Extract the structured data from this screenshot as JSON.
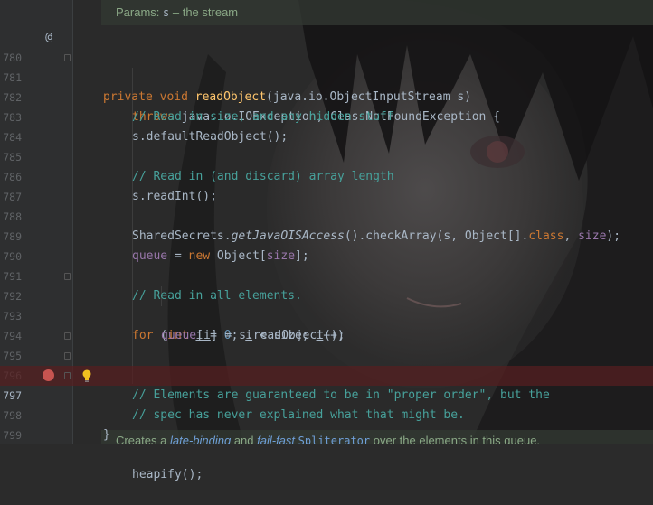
{
  "doc_top": {
    "label": "Params:",
    "param": "s",
    "desc": " – the stream"
  },
  "doc_bottom": {
    "text1": "Creates a ",
    "em1": "late-binding",
    "text2": " and ",
    "em2": "fail-fast",
    "text3": " ",
    "code": "Spliterator",
    "text4": " over the elements in this queue."
  },
  "lines": [
    {
      "num": "780"
    },
    {
      "num": "781"
    },
    {
      "num": "782"
    },
    {
      "num": "783"
    },
    {
      "num": "784"
    },
    {
      "num": "785"
    },
    {
      "num": "786"
    },
    {
      "num": "787"
    },
    {
      "num": "788"
    },
    {
      "num": "789"
    },
    {
      "num": "790"
    },
    {
      "num": "791"
    },
    {
      "num": "792"
    },
    {
      "num": "793"
    },
    {
      "num": "794"
    },
    {
      "num": "795"
    },
    {
      "num": "796"
    },
    {
      "num": "797"
    },
    {
      "num": "798"
    },
    {
      "num": "799"
    }
  ],
  "code": {
    "l780": {
      "kw1": "private",
      "kw2": "void",
      "fn": "readObject",
      "rest": "(java.io.ObjectInputStream s)"
    },
    "l781": {
      "kw": "throws",
      "rest": " java.io.IOException, ClassNotFoundException {"
    },
    "l782": {
      "cm": "// Read in size, and any hidden stuff"
    },
    "l783": {
      "text": "s.defaultReadObject();"
    },
    "l785": {
      "cm": "// Read in (and discard) array length"
    },
    "l786": {
      "text": "s.readInt();"
    },
    "l788": {
      "a": "SharedSecrets.",
      "it": "getJavaOISAccess",
      "b": "().checkArray(s, Object[].",
      "kw": "class",
      "c": ", ",
      "fld": "size",
      "d": ");"
    },
    "l789": {
      "fld": "queue",
      "a": " = ",
      "kw": "new",
      "b": " Object[",
      "fld2": "size",
      "c": "];"
    },
    "l791": {
      "cm": "// Read in all elements."
    },
    "l792": {
      "kw1": "for",
      "a": " (",
      "kw2": "int",
      "b": " ",
      "v1": "i",
      "c": " = ",
      "num": "0",
      "d": "; ",
      "v2": "i",
      "e": " < ",
      "f": "size",
      "g": "; ",
      "v3": "i",
      "h": "++)"
    },
    "l793": {
      "fld": "queue",
      "a": "[",
      "v": "i",
      "b": "] = s.readObject();"
    },
    "l795": {
      "cm": "// Elements are guaranteed to be in \"proper order\", but the"
    },
    "l796": {
      "cm": "// spec has never explained what that might be."
    },
    "l797": {
      "text": "heapify();"
    },
    "l798": {
      "text": "}"
    }
  },
  "gutter": {
    "override_glyph": "@"
  },
  "colors": {
    "background": "#2b2b2b",
    "keyword": "#cc7832",
    "method": "#ffc66d",
    "comment": "#47a19b",
    "field": "#9876aa",
    "number": "#6897bb",
    "breakpoint": "#c75450",
    "breakpoint_line": "#561e20"
  }
}
